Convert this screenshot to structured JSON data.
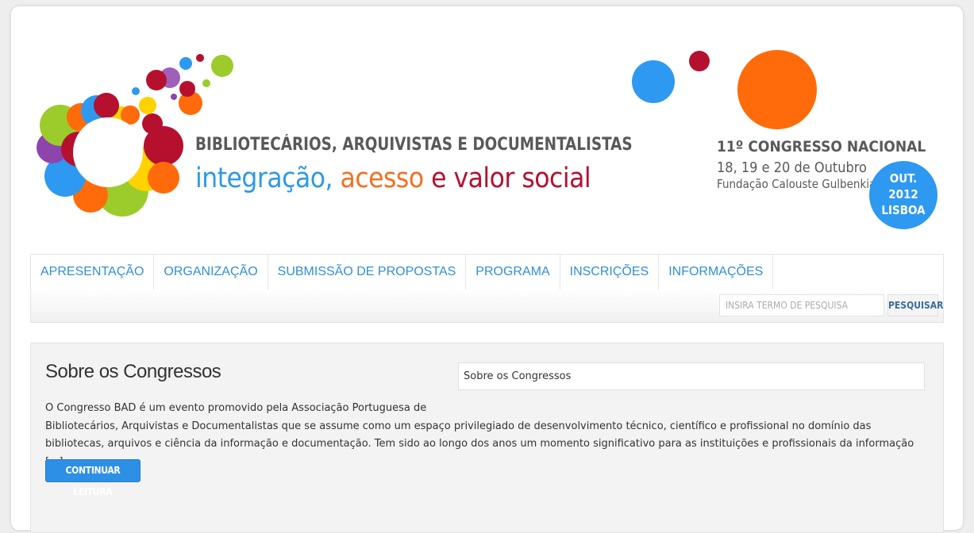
{
  "header": {
    "line1": "BIBLIOTECÁRIOS, ARQUIVISTAS E DOCUMENTALISTAS",
    "line2_part1": "integração,",
    "line2_part2": "acesso",
    "line2_part3": "e valor social",
    "congress_title": "11º CONGRESSO NACIONAL",
    "congress_dates": "18, 19 e 20 de Outubro",
    "congress_venue": "Fundação Calouste Gulbenkian",
    "badge_month": "OUT.",
    "badge_year": "2012",
    "badge_city": "LISBOA",
    "colors": {
      "blue": "#2e99f0",
      "orange": "#ff6b0a",
      "crimson": "#b6102f",
      "green": "#9ccc2c",
      "purple": "#8e44ad",
      "yellow": "#ffd200"
    }
  },
  "nav": {
    "items": [
      {
        "label": "APRESENTAÇÃO"
      },
      {
        "label": "ORGANIZAÇÃO"
      },
      {
        "label": "SUBMISSÃO DE PROPOSTAS"
      },
      {
        "label": "PROGRAMA"
      },
      {
        "label": "INSCRIÇÕES"
      },
      {
        "label": "INFORMAÇÕES"
      }
    ],
    "search_placeholder": "INSIRA TERMO DE PESQUISA",
    "search_button": "PESQUISAR"
  },
  "main": {
    "title": "Sobre os Congressos",
    "select_value": "Sobre os Congressos",
    "text_line1": "O Congresso BAD é um evento promovido pela Associação Portuguesa de",
    "text_rest": "Bibliotecários, Arquivistas e Documentalistas que se assume como um espaço privilegiado de desenvolvimento técnico, científico e profissional no domínio das bibliotecas, arquivos e ciência da informação e documentação. Tem sido ao longo dos anos um momento significativo para as instituições e profissionais da informação [...]",
    "button_label": "CONTINUAR LEITURA"
  }
}
